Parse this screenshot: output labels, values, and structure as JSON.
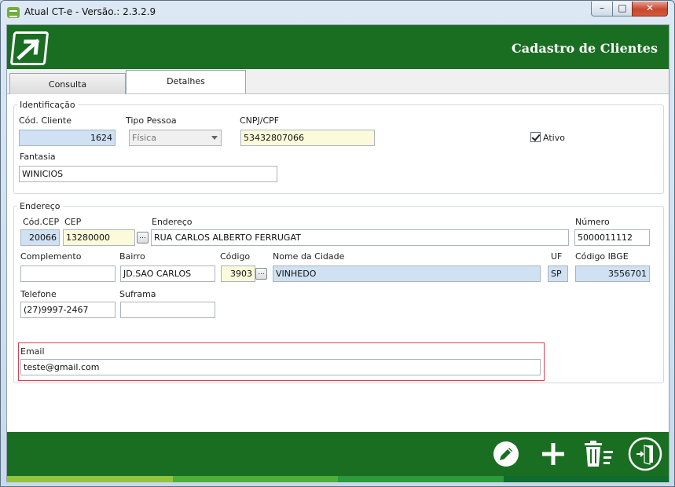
{
  "window": {
    "title": "Atual CT-e - Versão.: 2.3.2.9"
  },
  "header": {
    "title": "Cadastro de Clientes"
  },
  "tabs": [
    {
      "label": "Consulta"
    },
    {
      "label": "Detalhes"
    }
  ],
  "identificacao": {
    "legend": "Identificação",
    "cod_cliente": {
      "label": "Cód. Cliente",
      "value": "1624"
    },
    "tipo_pessoa": {
      "label": "Tipo Pessoa",
      "value": "Física"
    },
    "cnpj_cpf": {
      "label": "CNPJ/CPF",
      "value": "53432807066"
    },
    "ativo": {
      "label": "Ativo",
      "checked": true
    },
    "fantasia": {
      "label": "Fantasia",
      "value": "WINICIOS"
    }
  },
  "endereco": {
    "legend": "Endereço",
    "cod_cep": {
      "label": "Cód.CEP",
      "value": "20066"
    },
    "cep": {
      "label": "CEP",
      "value": "13280000"
    },
    "endereco": {
      "label": "Endereço",
      "value": "RUA CARLOS ALBERTO FERRUGAT"
    },
    "numero": {
      "label": "Número",
      "value": "5000011112"
    },
    "complemento": {
      "label": "Complemento",
      "value": ""
    },
    "bairro": {
      "label": "Bairro",
      "value": "JD.SAO CARLOS"
    },
    "codigo": {
      "label": "Código",
      "value": "3903"
    },
    "cidade": {
      "label": "Nome da Cidade",
      "value": "VINHEDO"
    },
    "uf": {
      "label": "UF",
      "value": "SP"
    },
    "ibge": {
      "label": "Código IBGE",
      "value": "3556701"
    },
    "telefone": {
      "label": "Telefone",
      "value": "(27)9997-2467"
    },
    "suframa": {
      "label": "Suframa",
      "value": ""
    },
    "email": {
      "label": "Email",
      "value": "teste@gmail.com"
    }
  },
  "ellipsis_glyph": "...",
  "window_buttons": {
    "minimize": "–",
    "maximize": "□",
    "close": "✕"
  },
  "toolbar": {
    "icons": [
      "edit-icon",
      "add-icon",
      "delete-icon",
      "exit-icon"
    ]
  },
  "colors": {
    "brand_green": "#1a6e22",
    "progress": [
      "#93c43e",
      "#4fae3a",
      "#2a9a3b",
      "#0d6c2e"
    ]
  }
}
